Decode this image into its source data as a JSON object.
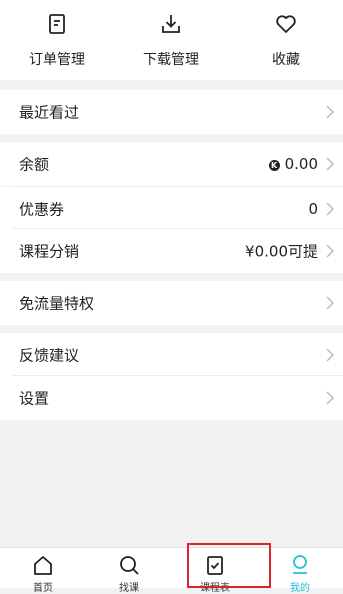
{
  "top_actions": [
    {
      "label": "订单管理",
      "icon": "order-icon"
    },
    {
      "label": "下载管理",
      "icon": "download-icon"
    },
    {
      "label": "收藏",
      "icon": "heart-icon"
    }
  ],
  "menu": {
    "recent": {
      "label": "最近看过"
    },
    "balance": {
      "label": "余额",
      "coin_symbol": "K",
      "value": "0.00"
    },
    "coupon": {
      "label": "优惠券",
      "value": "0"
    },
    "distribution": {
      "label": "课程分销",
      "value": "¥0.00可提"
    },
    "free_traffic": {
      "label": "免流量特权"
    },
    "feedback": {
      "label": "反馈建议"
    },
    "settings": {
      "label": "设置"
    }
  },
  "tabbar": [
    {
      "label": "首页",
      "icon": "home-icon",
      "active": false
    },
    {
      "label": "找课",
      "icon": "search-icon",
      "active": false
    },
    {
      "label": "课程表",
      "icon": "schedule-icon",
      "active": false
    },
    {
      "label": "我的",
      "icon": "profile-icon",
      "active": true
    }
  ],
  "colors": {
    "accent": "#2bbed1",
    "highlight_box": "#d9262c",
    "background": "#f2f2f2"
  }
}
